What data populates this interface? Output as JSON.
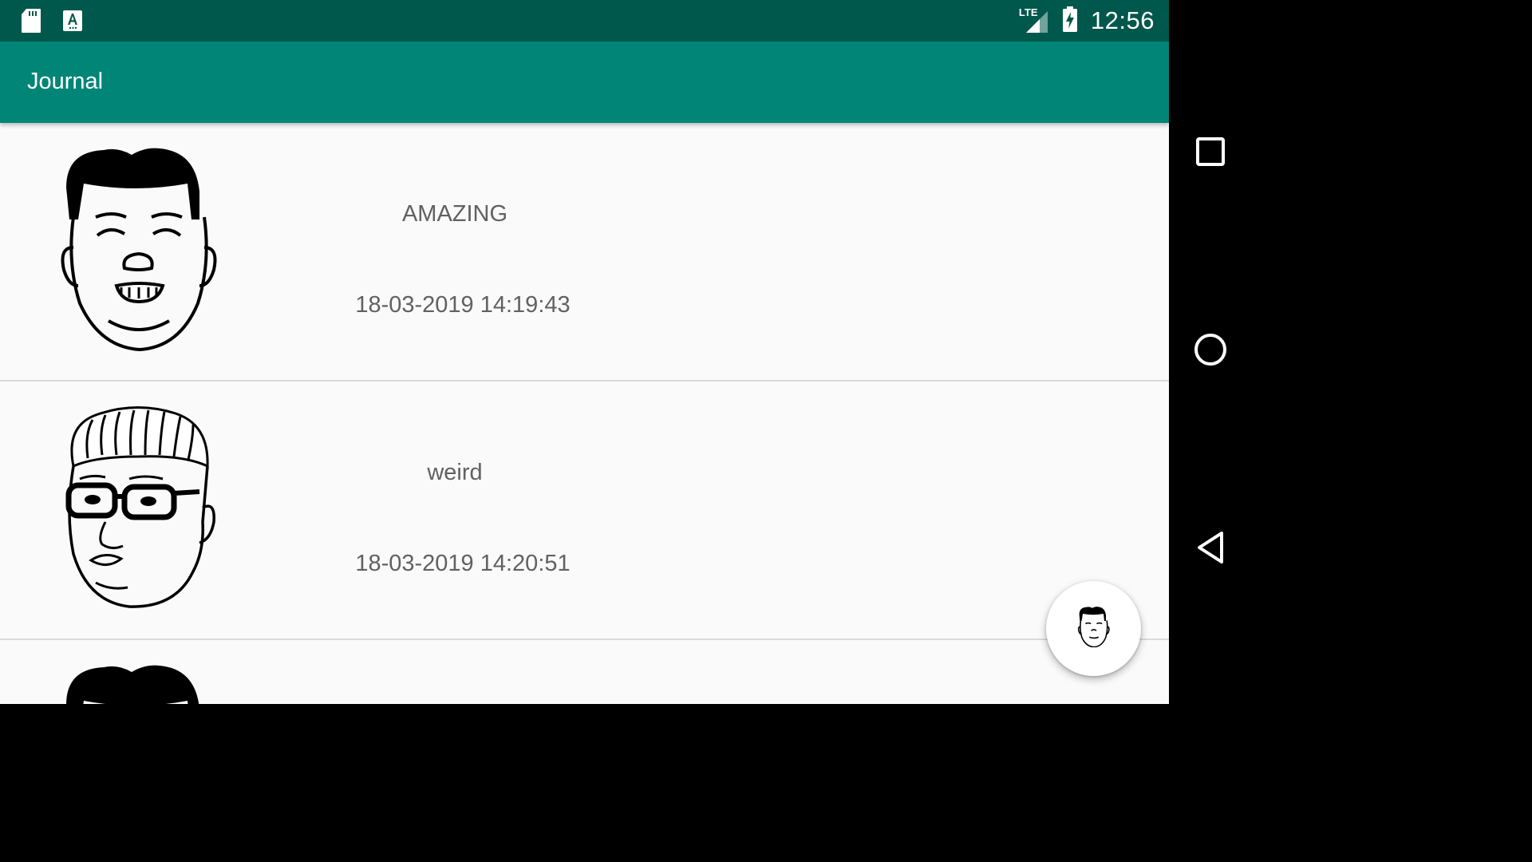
{
  "status_bar": {
    "time": "12:56",
    "network": "LTE",
    "icons": [
      "sd-card-icon",
      "keyboard-a-icon",
      "lte-signal-icon",
      "battery-charging-icon"
    ]
  },
  "app_bar": {
    "title": "Journal"
  },
  "entries": [
    {
      "mood": "AMAZING",
      "date": "18-03-2019 14:19:43",
      "avatar": "happy-face-icon"
    },
    {
      "mood": "weird",
      "date": "18-03-2019 14:20:51",
      "avatar": "glasses-face-icon"
    },
    {
      "mood": "",
      "date": "",
      "avatar": "happy-face-icon"
    }
  ],
  "fab": {
    "icon": "face-add-icon"
  },
  "nav_bar": {
    "buttons": [
      "recents-icon",
      "home-icon",
      "back-icon"
    ]
  },
  "colors": {
    "status_bar": "#00574b",
    "app_bar": "#008577",
    "background": "#fafafa",
    "text": "#616161"
  }
}
